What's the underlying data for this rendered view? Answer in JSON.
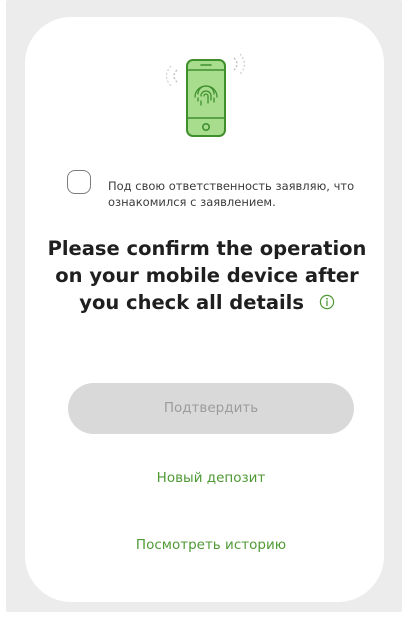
{
  "consent": {
    "checked": false,
    "text": "Под свою ответственность заявляю, что ознакомился с заявлением."
  },
  "title": {
    "text": "Please confirm the operation on your mobile device after you check all details"
  },
  "confirm_button": {
    "label": "Подтвердить",
    "state": "disabled"
  },
  "links": {
    "new_deposit": "Новый депозит",
    "view_history": "Посмотреть историю"
  },
  "icons": {
    "phone": "phone-fingerprint-icon",
    "info": "info-icon"
  },
  "colors": {
    "accent": "#4f9a35",
    "phone_fill": "#a9dd8e",
    "phone_stroke": "#3f8f2d",
    "button_bg": "#d9d9d9",
    "button_text": "#9c9c9c"
  }
}
